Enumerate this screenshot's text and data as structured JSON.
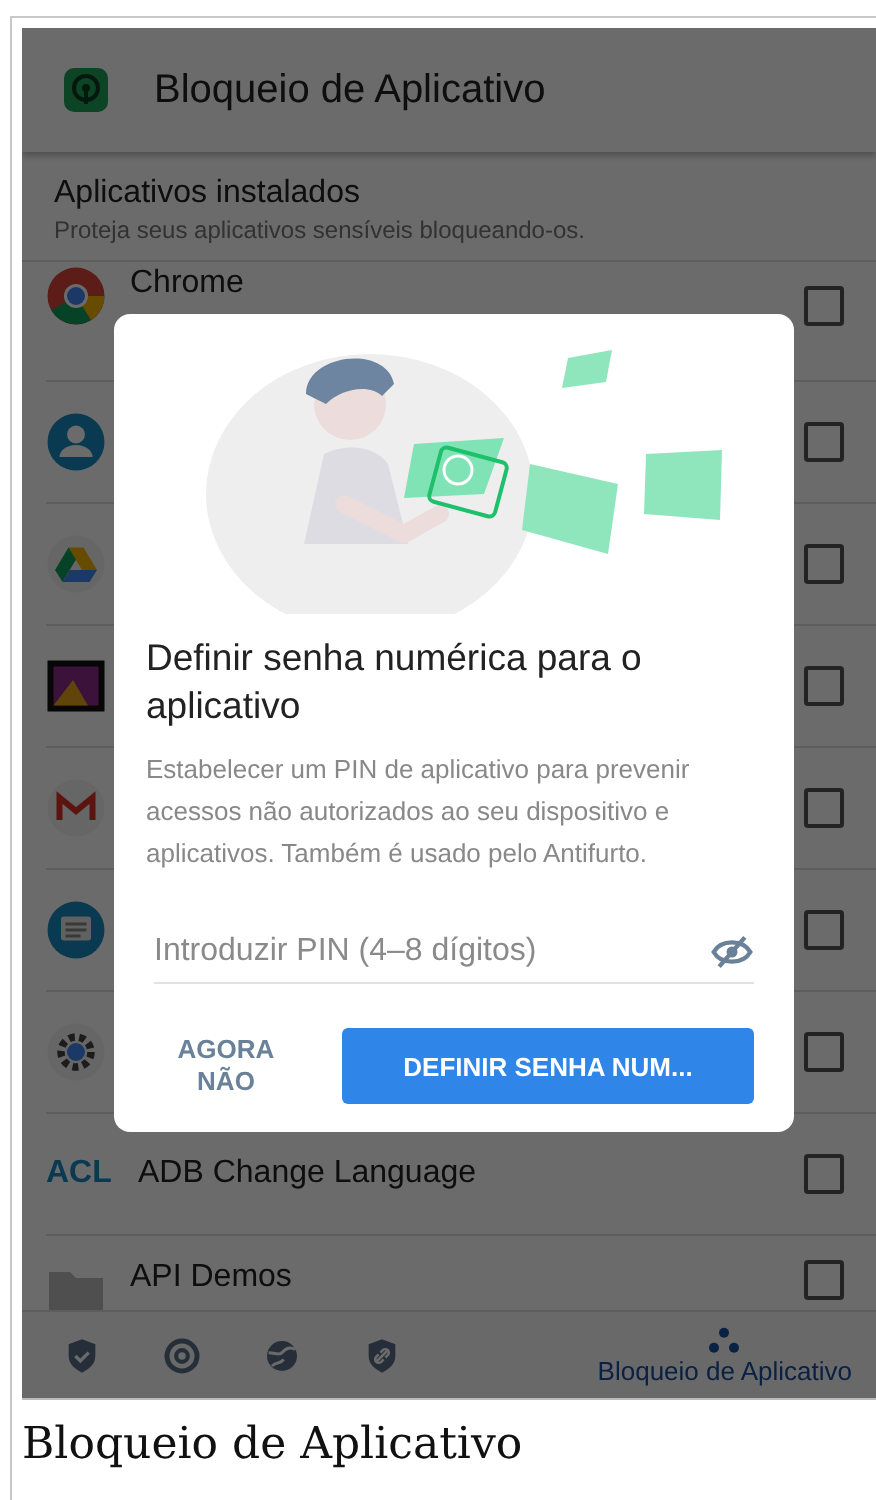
{
  "app_bar": {
    "title": "Bloqueio de Aplicativo"
  },
  "section": {
    "title": "Aplicativos instalados",
    "subtitle": "Proteja seus aplicativos sensíveis bloqueando-os."
  },
  "apps": [
    {
      "kind": "chrome",
      "name": "Chrome",
      "checked": false
    },
    {
      "kind": "contacts",
      "checked": false
    },
    {
      "kind": "drive",
      "checked": false
    },
    {
      "kind": "gallery",
      "checked": false
    },
    {
      "kind": "gmail",
      "checked": false
    },
    {
      "kind": "messages",
      "checked": false
    },
    {
      "kind": "settings",
      "checked": false
    },
    {
      "kind": "text",
      "icon_text": "ACL",
      "name": "ADB Change Language",
      "checked": false
    },
    {
      "kind": "folder",
      "name": "API Demos",
      "checked": false
    }
  ],
  "dialog": {
    "title": "Definir senha numérica para o aplicativo",
    "body": "Estabelecer um PIN de aplicativo para prevenir acessos não autorizados ao seu dispositivo e aplicativos. Também é usado pelo Antifurto.",
    "pin_field": {
      "placeholder": "Introduzir PIN (4–8 dígitos)"
    },
    "buttons": [
      {
        "kind": "text",
        "label": "AGORA NÃO"
      },
      {
        "kind": "primary",
        "label": "DEFINIR SENHA NUM..."
      }
    ]
  },
  "bottom_nav": [
    {
      "kind": "shield-check",
      "selected": false
    },
    {
      "kind": "target",
      "selected": false
    },
    {
      "kind": "globe",
      "selected": false
    },
    {
      "kind": "shield-link",
      "selected": false
    },
    {
      "kind": "dots",
      "label": "Bloqueio de Aplicativo",
      "selected": true
    }
  ],
  "caption": "Bloqueio de Aplicativo"
}
